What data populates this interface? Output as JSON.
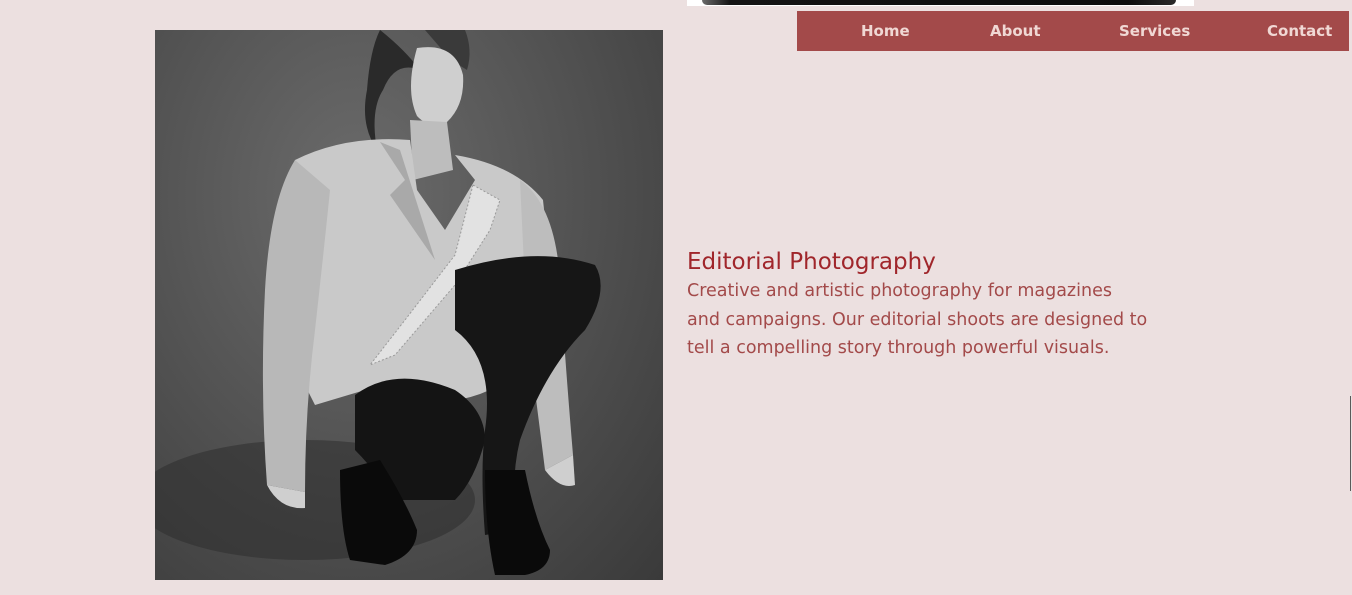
{
  "nav": {
    "items": [
      {
        "label": "Home"
      },
      {
        "label": "About"
      },
      {
        "label": "Services"
      },
      {
        "label": "Contact"
      }
    ]
  },
  "section": {
    "title": "Editorial Photography",
    "description_lines": [
      "Creative and artistic photography for magazines",
      "and campaigns. Our editorial shoots are designed to",
      "tell a compelling story through powerful visuals."
    ]
  },
  "colors": {
    "background": "#ece0e0",
    "accent": "#a34a4a",
    "title": "#a0262b",
    "nav_text": "#f0d8d4"
  }
}
